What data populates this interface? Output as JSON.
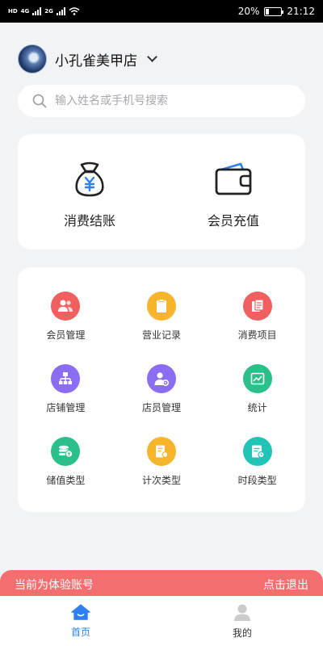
{
  "status_bar": {
    "left_indicators": [
      "HD",
      "4G",
      "2G"
    ],
    "battery_text": "20%",
    "battery_level": 0.2,
    "time": "21:12"
  },
  "store": {
    "name": "小孔雀美甲店"
  },
  "search": {
    "placeholder": "输入姓名或手机号搜索"
  },
  "quick_actions": [
    {
      "label": "消费结账",
      "icon": "money-bag-icon"
    },
    {
      "label": "会员充值",
      "icon": "wallet-icon"
    }
  ],
  "menu_items": [
    {
      "label": "会员管理",
      "icon": "members-icon",
      "color": "#f0605e"
    },
    {
      "label": "营业记录",
      "icon": "records-icon",
      "color": "#f7b52c"
    },
    {
      "label": "消费项目",
      "icon": "items-icon",
      "color": "#f0605e"
    },
    {
      "label": "店铺管理",
      "icon": "org-chart-icon",
      "color": "#8a6df0"
    },
    {
      "label": "店员管理",
      "icon": "staff-icon",
      "color": "#8a6df0"
    },
    {
      "label": "统计",
      "icon": "statistics-icon",
      "color": "#2bbf8a"
    },
    {
      "label": "储值类型",
      "icon": "coins-icon",
      "color": "#2bbf8a"
    },
    {
      "label": "计次类型",
      "icon": "count-card-icon",
      "color": "#f7b52c"
    },
    {
      "label": "时段类型",
      "icon": "time-doc-icon",
      "color": "#22c4b8"
    }
  ],
  "trial_banner": {
    "text": "当前为体验账号",
    "action": "点击退出"
  },
  "bottom_nav": [
    {
      "label": "首页",
      "active": true,
      "color": "#2f7ff0"
    },
    {
      "label": "我的",
      "active": false,
      "color": "#333333"
    }
  ]
}
